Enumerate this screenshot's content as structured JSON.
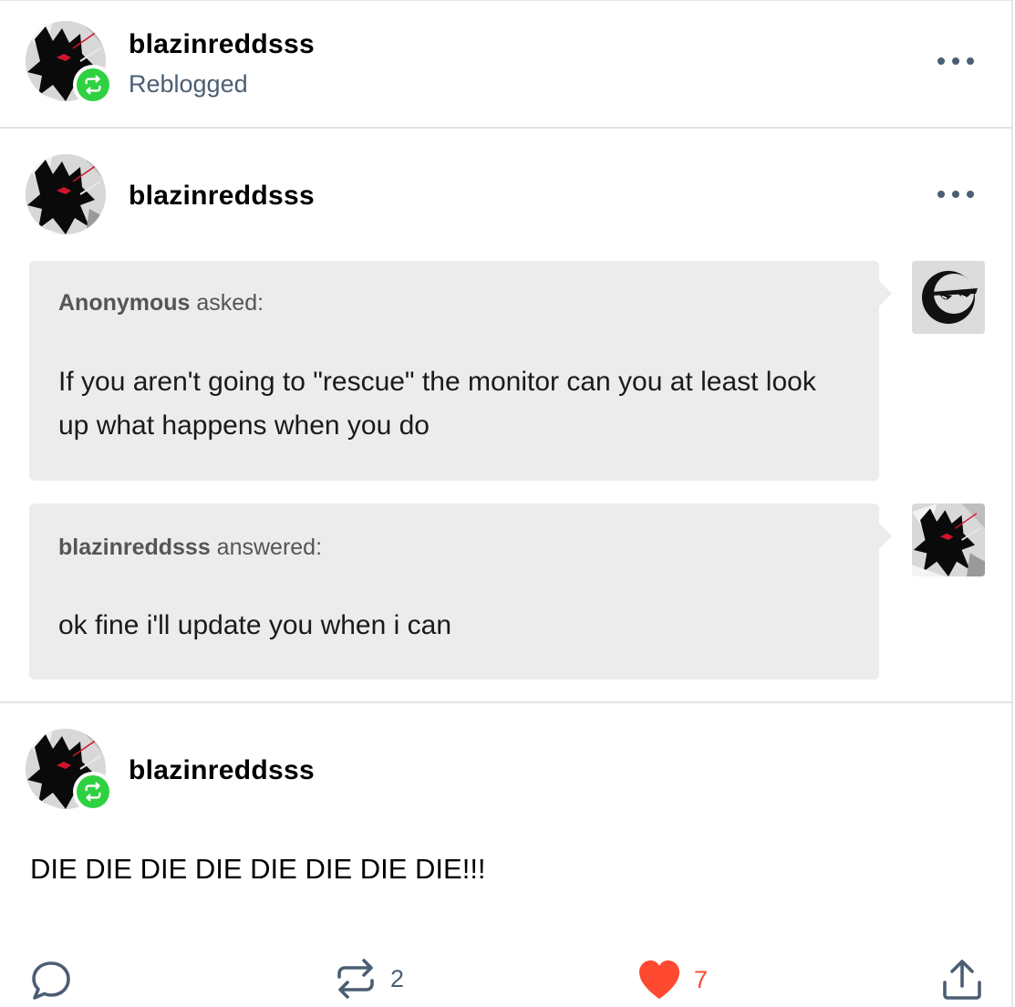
{
  "reblog_header": {
    "username": "blazinreddsss",
    "status": "Reblogged"
  },
  "original_post": {
    "username": "blazinreddsss",
    "ask": {
      "asker": "Anonymous",
      "verb": " asked:",
      "question": "If you aren't going to \"rescue\" the monitor can you at least look up what happens when you do",
      "asker_avatar": "sunglasses-face-icon"
    },
    "answer": {
      "answerer": "blazinreddsss",
      "verb": " answered:",
      "text": "ok fine i'll update you when i can"
    }
  },
  "reblog_comment": {
    "username": "blazinreddsss",
    "text": "DIE DIE DIE DIE DIE DIE DIE DIE!!!"
  },
  "footer": {
    "reply_icon": "speech-bubble-icon",
    "reblog_icon": "reblog-arrows-icon",
    "reblog_count": "2",
    "like_icon": "heart-icon",
    "like_count": "7",
    "share_icon": "share-upload-icon"
  },
  "colors": {
    "reblog_green": "#2ed140",
    "like_red": "#ff4930",
    "secondary_text": "#4b5e73",
    "bubble_bg": "#ececec"
  }
}
